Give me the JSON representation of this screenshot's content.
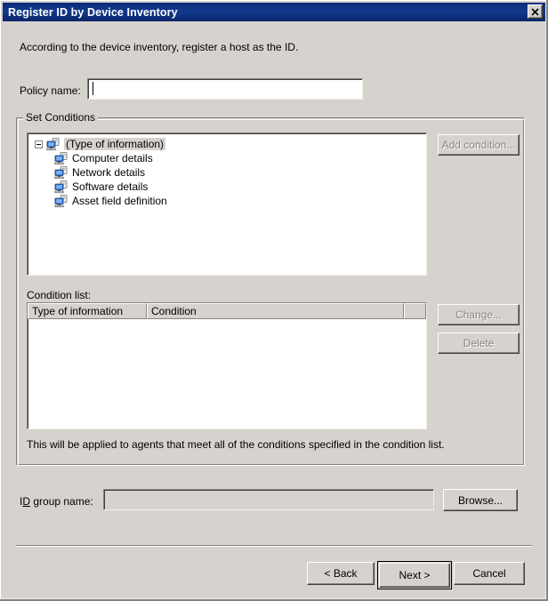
{
  "window": {
    "title": "Register ID by Device Inventory",
    "close_label": "✕"
  },
  "intro": {
    "text": "According to the device inventory, register a host as the ID."
  },
  "policy": {
    "label": "Policy name:",
    "value": "",
    "placeholder": ""
  },
  "set_conditions": {
    "group_title": "Set Conditions",
    "tree": {
      "root": {
        "label": "(Type of information)",
        "selected": true,
        "expanded": true
      },
      "children": [
        {
          "label": "Computer details"
        },
        {
          "label": "Network details"
        },
        {
          "label": "Software details"
        },
        {
          "label": "Asset field definition"
        }
      ]
    },
    "add_condition_label": "Add condition...",
    "condition_list": {
      "label": "Condition list:",
      "columns": [
        "Type of information",
        "Condition",
        ""
      ],
      "rows": []
    },
    "change_label": "Change...",
    "delete_label": "Delete"
  },
  "hint": {
    "text": "This will be applied to agents that meet all of the conditions specified in the condition list."
  },
  "id_group": {
    "label_prefix": "I",
    "label_mnemonic": "D",
    "label_suffix": " group name:",
    "value": "",
    "browse_label": "Browse..."
  },
  "footer": {
    "back_label": "< Back",
    "next_label": "Next >",
    "cancel_label": "Cancel"
  },
  "colors": {
    "titlebar": "#0b2a74",
    "face": "#d6d3ce",
    "field": "#ffffff",
    "disabled_text": "#85837e",
    "icon_blue": "#2a5fc8"
  }
}
